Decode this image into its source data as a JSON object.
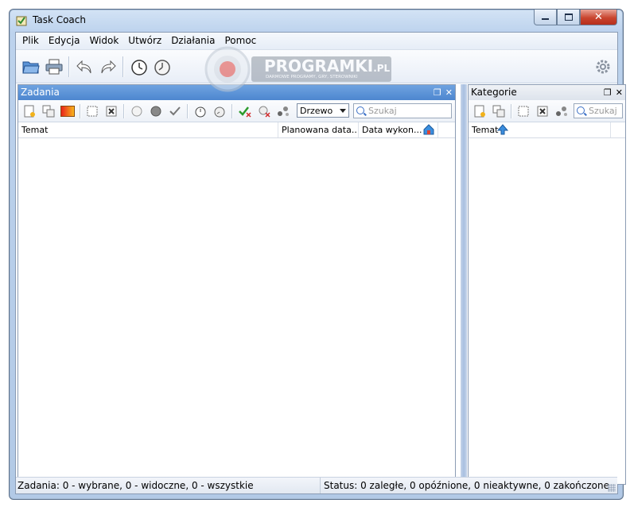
{
  "window": {
    "title": "Task Coach"
  },
  "menu": [
    "Plik",
    "Edycja",
    "Widok",
    "Utwórz",
    "Działania",
    "Pomoc"
  ],
  "watermark": {
    "brand": "PROGRAMKI",
    "brand_suffix": ".PL",
    "tagline": "DARMOWE PROGRAMY, GRY, STEROWNIKI"
  },
  "tasks_panel": {
    "title": "Zadania",
    "view_mode": "Drzewo",
    "search_placeholder": "Szukaj",
    "columns": [
      "Temat",
      "Planowana data...",
      "Data wykon..."
    ]
  },
  "categories_panel": {
    "title": "Kategorie",
    "search_placeholder": "Szukaj",
    "columns": [
      "Temat"
    ]
  },
  "status": {
    "left": "Zadania: 0 - wybrane, 0 - widoczne, 0 - wszystkie",
    "right": "Status: 0 zaległe, 0 opóźnione, 0 nieaktywne, 0 zakończone"
  },
  "colors": {
    "panel_header": "#4d86cf",
    "frame": "#b2c9e6",
    "close_button": "#c9452f"
  }
}
